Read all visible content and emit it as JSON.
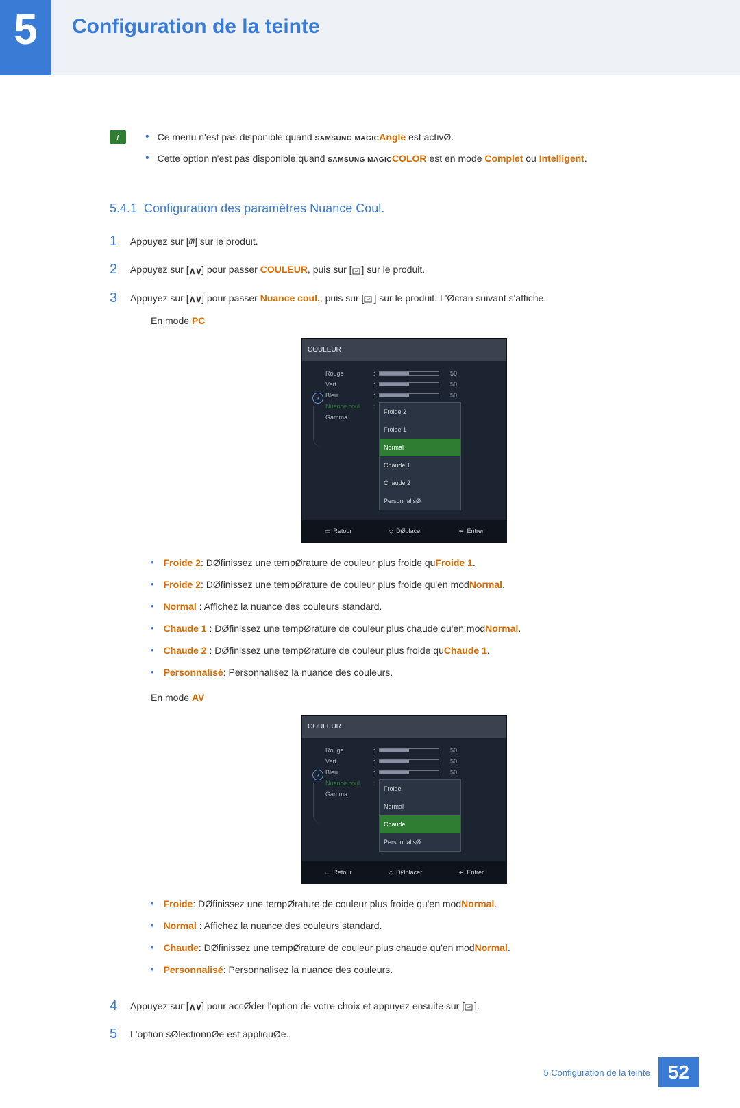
{
  "chapter": {
    "number": "5",
    "title": "Configuration de la teinte"
  },
  "notes": [
    {
      "pre": "Ce menu n'est pas disponible quand ",
      "brand": "SAMSUNG MAGIC",
      "feat": "Angle",
      "post": " est activØ."
    },
    {
      "pre": "Cette option n'est pas disponible quand ",
      "brand": "SAMSUNG MAGIC",
      "feat": "COLOR",
      "post": " est en mode ",
      "m1": "Complet",
      "sep": " ou ",
      "m2": "Intelligent",
      "end": "."
    }
  ],
  "section": {
    "number": "5.4.1",
    "title": "Configuration des paramètres Nuance Coul."
  },
  "steps": {
    "s1": {
      "n": "1",
      "pre": "Appuyez sur [",
      "key": "m",
      "post": "] sur le produit."
    },
    "s2": {
      "n": "2",
      "pre": "Appuyez sur [",
      "mid": "] pour passer   ",
      "target": "COULEUR",
      "mid2": ", puis sur [",
      "post": "] sur le produit."
    },
    "s3": {
      "n": "3",
      "pre": "Appuyez sur [",
      "mid": "] pour passer   ",
      "target": "Nuance coul.",
      "mid2": ", puis sur [",
      "post": "] sur le produit. L'Øcran suivant s'affiche."
    },
    "s4": {
      "n": "4",
      "pre": "Appuyez sur [",
      "mid": "] pour accØder l'option de votre choix et appuyez ensuite sur [",
      "post": "]."
    },
    "s5": {
      "n": "5",
      "text": "L'option sØlectionnØe est appliquØe."
    }
  },
  "mode_pc": {
    "label_pre": "En mode ",
    "label": "PC"
  },
  "mode_av": {
    "label_pre": "En mode ",
    "label": "AV"
  },
  "osd": {
    "title": "COULEUR",
    "rows": {
      "r": "Rouge",
      "v": "Vert",
      "b": "Bleu",
      "nc": "Nuance coul.",
      "g": "Gamma"
    },
    "vals": {
      "r": "50",
      "v": "50",
      "b": "50"
    },
    "dd_pc": [
      "Froide 2",
      "Froide 1",
      "Normal",
      "Chaude 1",
      "Chaude 2",
      "PersonnalisØ"
    ],
    "dd_pc_sel": 2,
    "dd_av": [
      "Froide",
      "Normal",
      "Chaude",
      "PersonnalisØ"
    ],
    "dd_av_sel": 2,
    "footer": {
      "ret": "Retour",
      "move": "DØplacer",
      "ent": "Entrer"
    }
  },
  "defs_pc": [
    {
      "term": "Froide 2",
      "text": ": DØfinissez une tempØrature de couleur plus froide qu",
      "tail_term": "Froide 1",
      "tail": "."
    },
    {
      "term": "Froide 2",
      "text": ": DØfinissez une tempØrature de couleur plus froide qu'en mod",
      "tail_term": "Normal",
      "tail": "."
    },
    {
      "term": "Normal",
      "text": " : Affichez la nuance des couleurs standard."
    },
    {
      "term": "Chaude 1",
      "text": " : DØfinissez une tempØrature de couleur plus chaude qu'en mod",
      "tail_term": "Normal",
      "tail": "."
    },
    {
      "term": "Chaude 2",
      "text": " : DØfinissez une tempØrature de couleur plus froide qu",
      "tail_term": "Chaude 1",
      "tail": "."
    },
    {
      "term": "Personnalisé",
      "text": ": Personnalisez la nuance des couleurs."
    }
  ],
  "defs_av": [
    {
      "term": "Froide",
      "text": ": DØfinissez une tempØrature de couleur plus froide qu'en mod",
      "tail_term": "Normal",
      "tail": "."
    },
    {
      "term": "Normal",
      "text": " : Affichez la nuance des couleurs standard."
    },
    {
      "term": "Chaude",
      "text": ": DØfinissez une tempØrature de couleur plus chaude qu'en mod",
      "tail_term": "Normal",
      "tail": "."
    },
    {
      "term": "Personnalisé",
      "text": ": Personnalisez la nuance des couleurs."
    }
  ],
  "footer": {
    "text": "5 Configuration de la teinte",
    "page": "52"
  }
}
